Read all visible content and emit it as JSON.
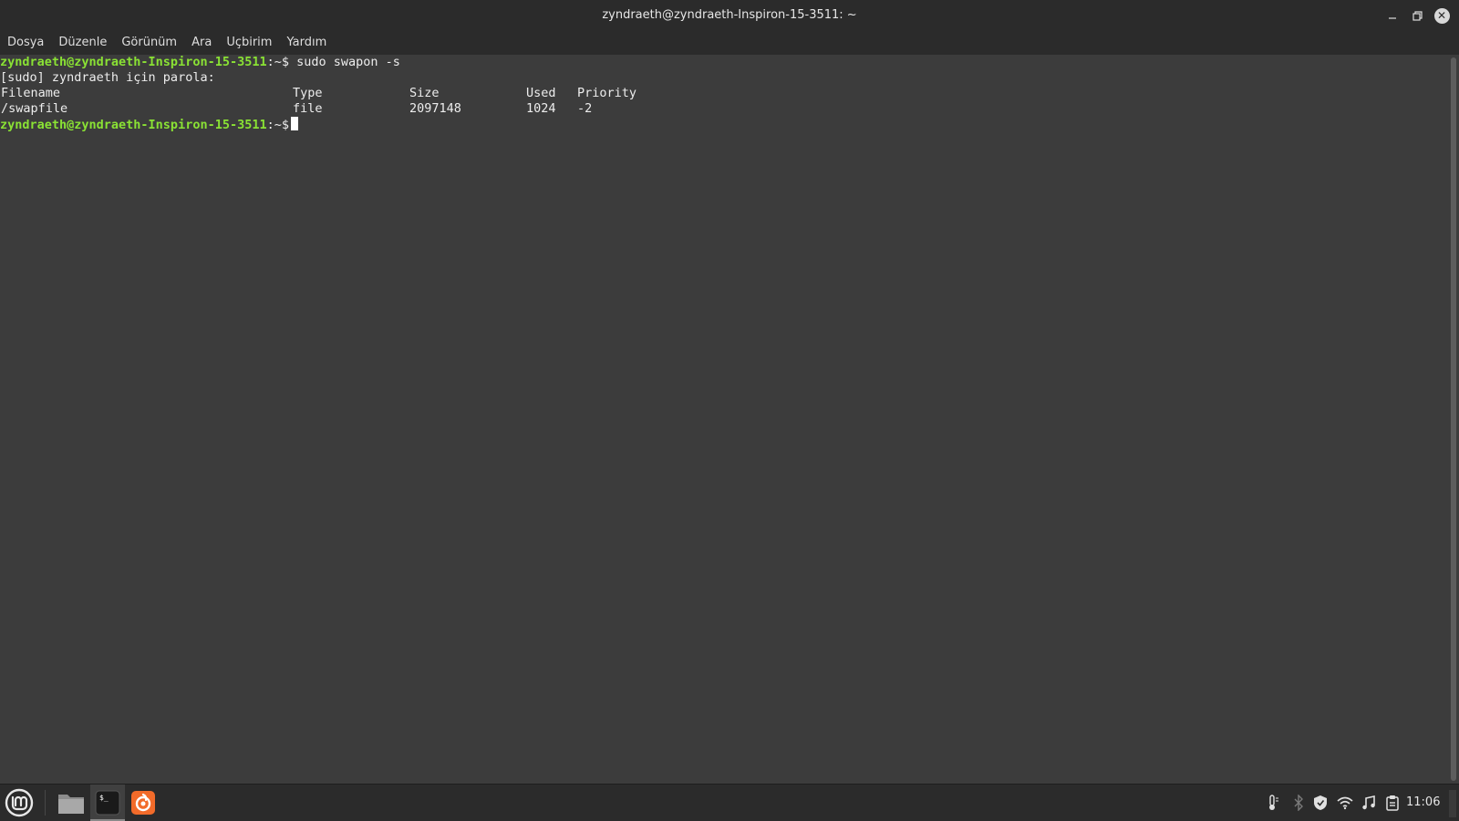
{
  "window": {
    "title": "zyndraeth@zyndraeth-Inspiron-15-3511: ~",
    "controls": {
      "minimize_icon": "minimize-icon",
      "maximize_icon": "maximize-icon",
      "close_icon": "close-icon"
    }
  },
  "menubar": {
    "items": [
      {
        "label": "Dosya"
      },
      {
        "label": "Düzenle"
      },
      {
        "label": "Görünüm"
      },
      {
        "label": "Ara"
      },
      {
        "label": "Uçbirim"
      },
      {
        "label": "Yardım"
      }
    ]
  },
  "terminal": {
    "colors": {
      "background": "#3c3c3c",
      "prompt": "#8ae234",
      "text": "#ededed"
    },
    "prompt_user_host": "zyndraeth@zyndraeth-Inspiron-15-3511",
    "prompt_suffix": ":~$",
    "line1_command": " sudo swapon -s",
    "line2_text": "[sudo] zyndraeth için parola:",
    "table": {
      "headers": [
        "Filename",
        "Type",
        "Size",
        "Used",
        "Priority"
      ],
      "rows": [
        [
          "/swapfile",
          "file",
          "2097148",
          "1024",
          "-2"
        ]
      ]
    }
  },
  "taskbar": {
    "menu_icon": "linux-mint-logo-icon",
    "apps": [
      {
        "name": "files-icon",
        "active": false
      },
      {
        "name": "terminal-icon",
        "active": true
      },
      {
        "name": "firefox-icon",
        "active": false
      }
    ],
    "tray": [
      "thermometer-icon",
      "bluetooth-icon",
      "shield-icon",
      "wifi-icon",
      "music-note-icon",
      "clipboard-icon"
    ],
    "clock": "11:06"
  }
}
